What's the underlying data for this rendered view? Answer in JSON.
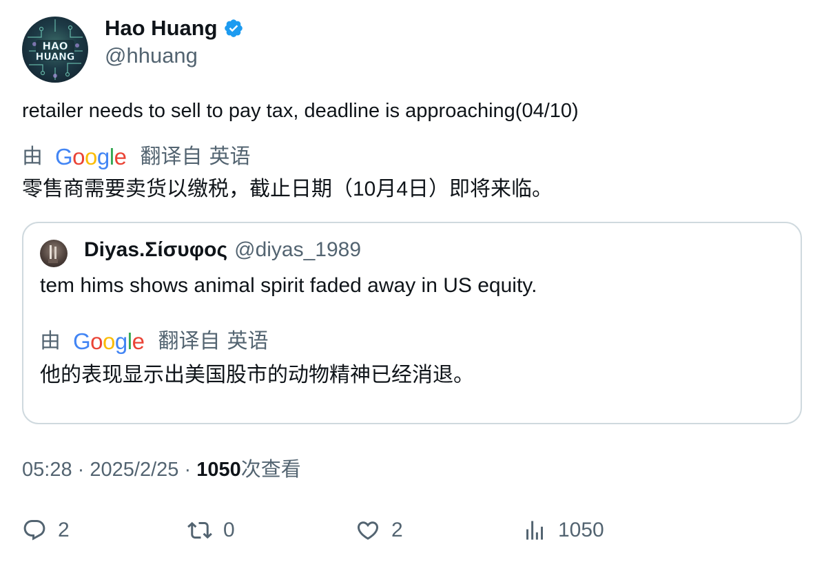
{
  "author": {
    "display_name": "Hao Huang",
    "handle": "@hhuang",
    "avatar_text": "HAO HUANG",
    "verified_icon": "verified-badge-icon"
  },
  "tweet": {
    "text": "retailer needs to sell to pay tax, deadline is approaching(04/10)",
    "translation": {
      "by": "由",
      "provider": "Google",
      "from_label": "翻译自",
      "language": "英语",
      "text": "零售商需要卖货以缴税，截止日期（10月4日）即将来临。"
    }
  },
  "quote": {
    "display_name": "Diyas.Σίσυφος",
    "handle": "@diyas_1989",
    "text": "tem hims shows animal spirit faded away in US equity.",
    "translation": {
      "by": "由",
      "provider": "Google",
      "from_label": "翻译自",
      "language": "英语",
      "text": "他的表现显示出美国股市的动物精神已经消退。"
    }
  },
  "meta": {
    "time": "05:28",
    "separator": "·",
    "date": "2025/2/25",
    "views_count": "1050",
    "views_label": "次查看"
  },
  "actions": {
    "reply_count": "2",
    "retweet_count": "0",
    "like_count": "2",
    "views_count": "1050"
  },
  "colors": {
    "text_primary": "#0f1419",
    "text_secondary": "#536471",
    "border": "#cfd9de",
    "verified": "#1d9bf0"
  }
}
